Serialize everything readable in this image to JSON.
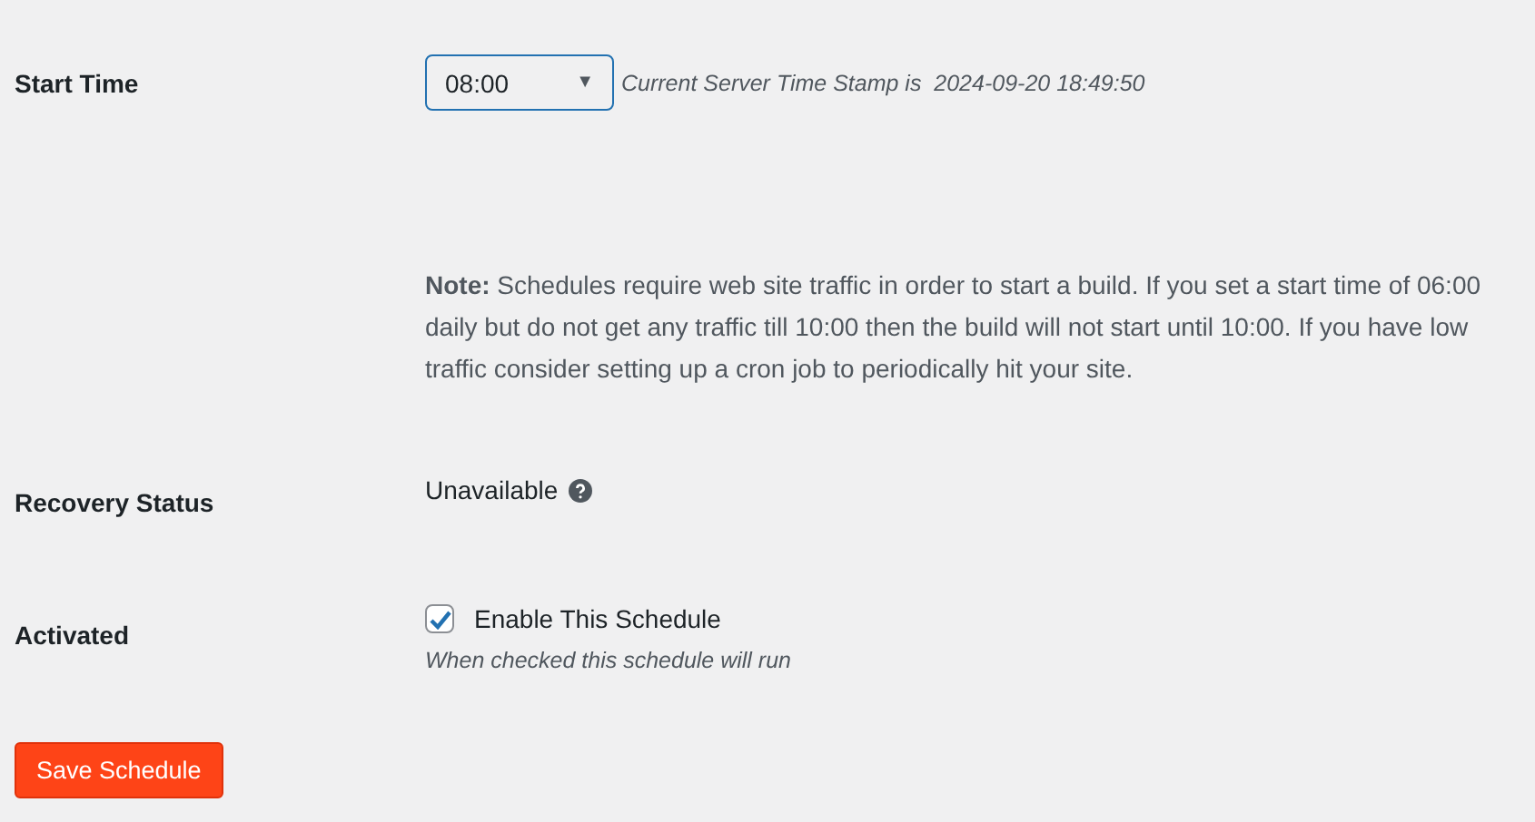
{
  "rows": [
    {
      "kind": "select",
      "label": "Start Time",
      "value": "08:00",
      "caret": "▼",
      "hint": "Current Server Time Stamp is  2024-09-20 18:49:50"
    },
    {
      "kind": "note",
      "text": "**Note:** Schedules require web site traffic in order to start a build. If you set a start time of 06:00 daily but do not get any traffic till 10:00 then the build will not start until 10:00. If you have low traffic consider setting up a cron job to periodically hit your site."
    },
    {
      "kind": "status",
      "label": "Recovery Status",
      "value": "Unavailable"
    },
    {
      "kind": "checkbox",
      "label": "Activated",
      "option": "Enable This Schedule",
      "checked": true,
      "description": "When checked this schedule will run"
    }
  ],
  "save_button": "Save Schedule"
}
